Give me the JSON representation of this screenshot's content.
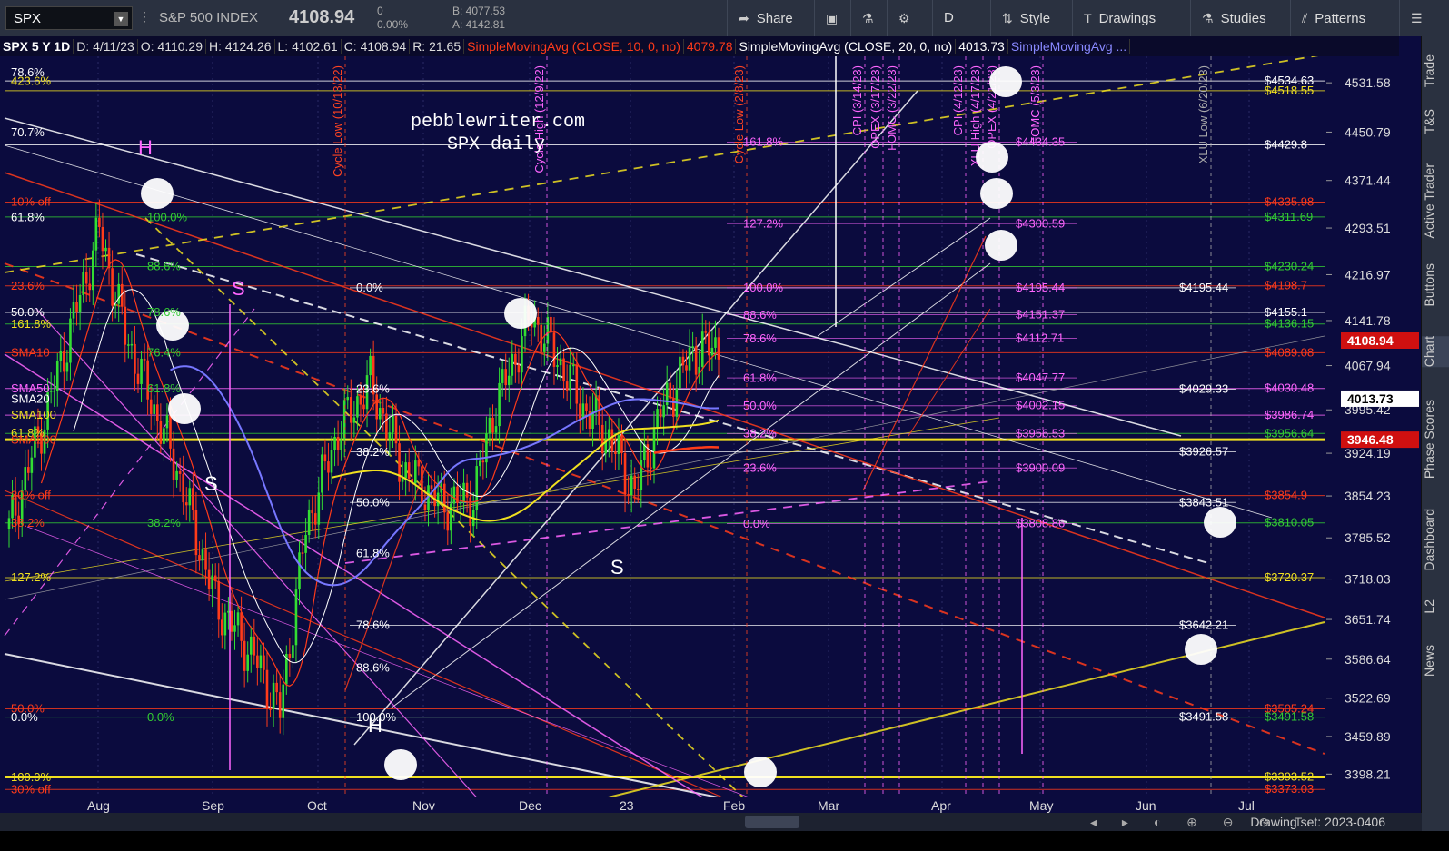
{
  "toolbar": {
    "symbol": "SPX",
    "index_name": "S&P 500 INDEX",
    "last": "4108.94",
    "change": "0",
    "change_pct": "0.00%",
    "bid": "B: 4077.53",
    "ask": "A: 4142.81",
    "share": "Share",
    "period": "D",
    "style": "Style",
    "drawings": "Drawings",
    "studies": "Studies",
    "patterns": "Patterns"
  },
  "infobar": {
    "sym": "SPX 5 Y 1D",
    "date": "D: 4/11/23",
    "open": "O: 4110.29",
    "high": "H: 4124.26",
    "low": "L: 4102.61",
    "close": "C: 4108.94",
    "range": "R: 21.65",
    "sma10": "SimpleMovingAvg (CLOSE, 10, 0, no)",
    "sma10_val": "4079.78",
    "sma20": "SimpleMovingAvg (CLOSE, 20, 0, no)",
    "sma20_val": "4013.73",
    "sma_more": "SimpleMovingAvg ..."
  },
  "sidebar": {
    "tabs": [
      "Trade",
      "T&S",
      "Active Trader",
      "Buttons",
      "Chart",
      "Phase Scores",
      "Dashboard",
      "L2",
      "News"
    ]
  },
  "bottom": {
    "drawing_set": "Drawing set: 2023-0406"
  },
  "colors": {
    "bg": "#0b0b3e",
    "red": "#ff3b1a",
    "yellow": "#f0e020",
    "magenta": "#ff66ff",
    "green": "#33cc33",
    "white": "#ffffff",
    "blue": "#7777ff"
  },
  "chart_data": {
    "type": "candlestick",
    "watermark": [
      "pebblewriter.com",
      "SPX daily"
    ],
    "x_ticks": [
      "Aug",
      "Sep",
      "Oct",
      "Nov",
      "Dec",
      "23",
      "Feb",
      "Mar",
      "Apr",
      "May",
      "Jun",
      "Jul"
    ],
    "y_ticks": [
      4531.58,
      4450.79,
      4371.44,
      4293.51,
      4216.97,
      4141.78,
      4067.94,
      3995.42,
      3924.19,
      3854.23,
      3785.52,
      3718.03,
      3651.74,
      3586.64,
      3522.69,
      3459.89,
      3398.21
    ],
    "ylim": [
      3360,
      4575
    ],
    "price_markers": [
      {
        "value": "4108.94",
        "price": 4108.94,
        "color": "#d01010"
      },
      {
        "value": "4013.73",
        "price": 4013.73,
        "color": "#ffffff"
      },
      {
        "value": "3946.48",
        "price": 3946.48,
        "color": "#d01010"
      }
    ],
    "vertical_events": [
      {
        "label": "Cycle Low (10/13/22)",
        "color": "#ff4422"
      },
      {
        "label": "Cycle High (12/9/22)",
        "color": "#ff66ff"
      },
      {
        "label": "Cycle Low (2/8/23)",
        "color": "#ff4422"
      },
      {
        "label": "CPI (3/14/23)",
        "color": "#ff66ff"
      },
      {
        "label": "OPEX (3/17/23)",
        "color": "#ff66ff"
      },
      {
        "label": "FOMC (3/22/23)",
        "color": "#ff66ff"
      },
      {
        "label": "CPI (4/12/23)",
        "color": "#ff66ff"
      },
      {
        "label": "XLU High (4/17/23)",
        "color": "#ff66ff"
      },
      {
        "label": "OPEX (4/21/23)",
        "color": "#ff66ff"
      },
      {
        "label": "FOMC (5/3/23)",
        "color": "#ff66ff"
      },
      {
        "label": "XLU Low (6/20/23)",
        "color": "#aaaaaa"
      }
    ],
    "right_price_labels": [
      {
        "text": "$4534.63",
        "price": 4534.63,
        "color": "#ffffff"
      },
      {
        "text": "$4518.55",
        "price": 4518.55,
        "color": "#f0e020"
      },
      {
        "text": "$4429.8",
        "price": 4429.8,
        "color": "#ffffff"
      },
      {
        "text": "$4335.98",
        "price": 4335.98,
        "color": "#ff3b1a"
      },
      {
        "text": "$4311.69",
        "price": 4311.69,
        "color": "#33cc33"
      },
      {
        "text": "$4230.24",
        "price": 4230.24,
        "color": "#33cc33"
      },
      {
        "text": "$4198.7",
        "price": 4198.7,
        "color": "#ff3b1a"
      },
      {
        "text": "$4155.1",
        "price": 4155.1,
        "color": "#ffffff"
      },
      {
        "text": "$4136.15",
        "price": 4136.15,
        "color": "#33cc33"
      },
      {
        "text": "$4089.08",
        "price": 4089.08,
        "color": "#ff3b1a"
      },
      {
        "text": "$4030.48",
        "price": 4030.48,
        "color": "#ff66ff"
      },
      {
        "text": "$3986.74",
        "price": 3986.74,
        "color": "#ff66ff"
      },
      {
        "text": "$3956.64",
        "price": 3956.64,
        "color": "#33cc33"
      },
      {
        "text": "$3854.9",
        "price": 3854.9,
        "color": "#ff3b1a"
      },
      {
        "text": "$3810.05",
        "price": 3810.05,
        "color": "#33cc33"
      },
      {
        "text": "$3720.37",
        "price": 3720.37,
        "color": "#f0e020"
      },
      {
        "text": "$3505.24",
        "price": 3505.24,
        "color": "#ff3b1a"
      },
      {
        "text": "$3491.58",
        "price": 3491.58,
        "color": "#33cc33"
      },
      {
        "text": "$3393.52",
        "price": 3393.52,
        "color": "#f0e020"
      },
      {
        "text": "$3373.03",
        "price": 3373.03,
        "color": "#ff3b1a"
      }
    ],
    "mid_price_labels": [
      {
        "text": "$4195.44",
        "price": 4195.44
      },
      {
        "text": "$4029.33",
        "price": 4029.33
      },
      {
        "text": "$3926.57",
        "price": 3926.57
      },
      {
        "text": "$3843.51",
        "price": 3843.51
      },
      {
        "text": "$3642.21",
        "price": 3642.21
      },
      {
        "text": "$3491.58",
        "price": 3491.58
      }
    ],
    "fib_set_magenta": [
      {
        "text": "$4434.35",
        "price": 4434.35
      },
      {
        "text": "$4300.59",
        "price": 4300.59
      },
      {
        "text": "$4195.44",
        "price": 4195.44
      },
      {
        "text": "$4151.37",
        "price": 4151.37
      },
      {
        "text": "$4112.71",
        "price": 4112.71
      },
      {
        "text": "$4047.77",
        "price": 4047.77
      },
      {
        "text": "$4002.15",
        "price": 4002.15
      },
      {
        "text": "$3956.53",
        "price": 3956.53
      },
      {
        "text": "$3900.09",
        "price": 3900.09
      },
      {
        "text": "$3808.86",
        "price": 3808.86
      }
    ],
    "fib_pct_magenta": [
      {
        "text": "161.8%",
        "price": 4434
      },
      {
        "text": "127.2%",
        "price": 4300
      },
      {
        "text": "100.0%",
        "price": 4195
      },
      {
        "text": "88.6%",
        "price": 4151
      },
      {
        "text": "78.6%",
        "price": 4112
      },
      {
        "text": "61.8%",
        "price": 4047
      },
      {
        "text": "50.0%",
        "price": 4002
      },
      {
        "text": "38.2%",
        "price": 3956
      },
      {
        "text": "23.6%",
        "price": 3900
      },
      {
        "text": "0.0%",
        "price": 3808
      }
    ],
    "fib_pct_white": [
      {
        "text": "0.0%",
        "price": 4195
      },
      {
        "text": "23.6%",
        "price": 4029
      },
      {
        "text": "38.2%",
        "price": 3926
      },
      {
        "text": "50.0%",
        "price": 3843
      },
      {
        "text": "61.8%",
        "price": 3760
      },
      {
        "text": "78.6%",
        "price": 3642
      },
      {
        "text": "88.6%",
        "price": 3572
      },
      {
        "text": "100.0%",
        "price": 3491
      }
    ],
    "fib_pct_green": [
      {
        "text": "100.0%",
        "price": 4311
      },
      {
        "text": "88.6%",
        "price": 4230
      },
      {
        "text": "78.6%",
        "price": 4155
      },
      {
        "text": "76.4%",
        "price": 4089
      },
      {
        "text": "61.8%",
        "price": 4030
      },
      {
        "text": "38.2%",
        "price": 3810
      },
      {
        "text": "0.0%",
        "price": 3491
      }
    ],
    "left_labels": [
      {
        "text": "78.6%",
        "price": 4548,
        "color": "#ffffff"
      },
      {
        "text": "423.6%",
        "price": 4534,
        "color": "#f0e020"
      },
      {
        "text": "70.7%",
        "price": 4450,
        "color": "#ffffff"
      },
      {
        "text": "10% off",
        "price": 4336,
        "color": "#ff3b1a"
      },
      {
        "text": "61.8%",
        "price": 4311,
        "color": "#ffffff"
      },
      {
        "text": "23.6%",
        "price": 4198,
        "color": "#ff3b1a"
      },
      {
        "text": "50.0%",
        "price": 4155,
        "color": "#ffffff"
      },
      {
        "text": "161.8%",
        "price": 4136,
        "color": "#f0e020"
      },
      {
        "text": "SMA10",
        "price": 4089,
        "color": "#ff3b1a"
      },
      {
        "text": "SMA50",
        "price": 4030,
        "color": "#ff66ff"
      },
      {
        "text": "SMA20",
        "price": 4013,
        "color": "#ffffff"
      },
      {
        "text": "SMA100",
        "price": 3987,
        "color": "#f0e020"
      },
      {
        "text": "61.8%",
        "price": 3957,
        "color": "#f0e020"
      },
      {
        "text": "SMA200",
        "price": 3946,
        "color": "#ff3b1a"
      },
      {
        "text": "20% off",
        "price": 3855,
        "color": "#ff3b1a"
      },
      {
        "text": "38.2%",
        "price": 3810,
        "color": "#ff3b1a"
      },
      {
        "text": "127.2%",
        "price": 3720,
        "color": "#f0e020"
      },
      {
        "text": "50.0%",
        "price": 3505,
        "color": "#ff3b1a"
      },
      {
        "text": "0.0%",
        "price": 3491,
        "color": "#ffffff"
      },
      {
        "text": "100.0%",
        "price": 3393,
        "color": "#f0e020"
      },
      {
        "text": "30% off",
        "price": 3373,
        "color": "#ff3b1a"
      }
    ],
    "pattern_labels": [
      "H",
      "S",
      "S",
      "S",
      "H"
    ],
    "ohlc_last": {
      "date": "4/11/23",
      "open": 4110.29,
      "high": 4124.26,
      "low": 4102.61,
      "close": 4108.94
    }
  }
}
